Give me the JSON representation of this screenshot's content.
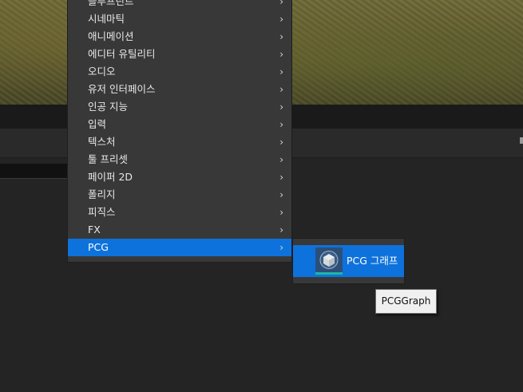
{
  "menu": {
    "items": [
      {
        "label": "블루프린트"
      },
      {
        "label": "시네마틱"
      },
      {
        "label": "애니메이션"
      },
      {
        "label": "에디터 유틸리티"
      },
      {
        "label": "오디오"
      },
      {
        "label": "유저 인터페이스"
      },
      {
        "label": "인공 지능"
      },
      {
        "label": "입력"
      },
      {
        "label": "텍스처"
      },
      {
        "label": "툴 프리셋"
      },
      {
        "label": "페이퍼 2D"
      },
      {
        "label": "폴리지"
      },
      {
        "label": "피직스"
      },
      {
        "label": "FX"
      },
      {
        "label": "PCG",
        "selected": true
      }
    ],
    "chevron": "chevron-right-icon",
    "accent_color": "#0e72dc"
  },
  "submenu": {
    "items": [
      {
        "label": "PCG 그래프",
        "icon": "pcg-graph-icon"
      }
    ]
  },
  "tooltip": {
    "text": "PCGGraph"
  }
}
